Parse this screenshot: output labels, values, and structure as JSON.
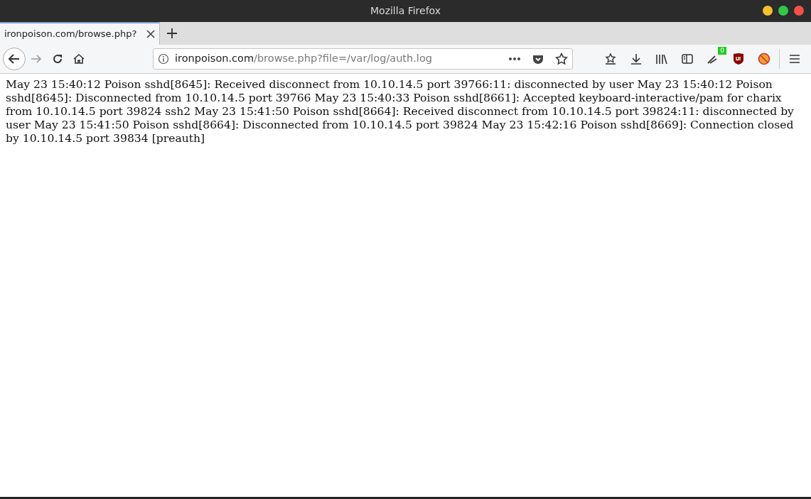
{
  "window": {
    "title": "Mozilla Firefox"
  },
  "tabs": [
    {
      "label": "ironpoison.com/browse.php?",
      "selected": true
    }
  ],
  "address_bar": {
    "domain": "ironpoison.com",
    "path": "/browse.php?file=/var/log/auth.log"
  },
  "toolbar": {
    "extension_badge": "0"
  },
  "page": {
    "text": "May 23 15:40:12 Poison sshd[8645]: Received disconnect from 10.10.14.5 port 39766:11: disconnected by user May 23 15:40:12 Poison sshd[8645]: Disconnected from 10.10.14.5 port 39766 May 23 15:40:33 Poison sshd[8661]: Accepted keyboard-interactive/pam for charix from 10.10.14.5 port 39824 ssh2 May 23 15:41:50 Poison sshd[8664]: Received disconnect from 10.10.14.5 port 39824:11: disconnected by user May 23 15:41:50 Poison sshd[8664]: Disconnected from 10.10.14.5 port 39824 May 23 15:42:16 Poison sshd[8669]: Connection closed by 10.10.14.5 port 39834 [preauth]"
  }
}
